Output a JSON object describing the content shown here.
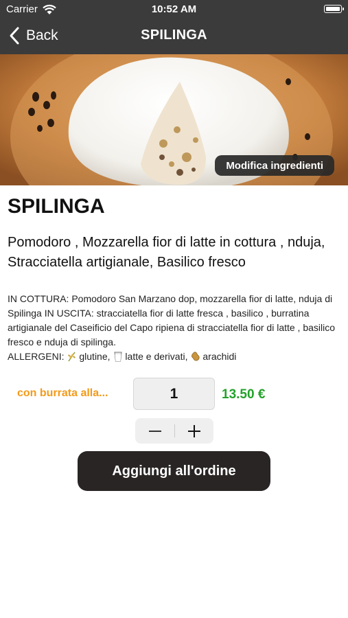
{
  "status": {
    "carrier": "Carrier",
    "time": "10:52 AM"
  },
  "nav": {
    "back_label": "Back",
    "title": "SPILINGA"
  },
  "hero": {
    "edit_label": "Modifica ingredienti"
  },
  "product": {
    "name": "SPILINGA",
    "ingredients": "Pomodoro , Mozzarella fior di latte in cottura , nduja, Stracciatella artigianale, Basilico fresco",
    "description": "IN COTTURA: Pomodoro San Marzano dop, mozzarella fior di latte, nduja di Spilinga  IN USCITA: stracciatella fior di latte fresca , basilico , burratina artigianale del Caseificio del Capo ripiena di stracciatella fior di latte , basilico fresco e nduja di spilinga.",
    "allergens_label": "ALLERGENI:",
    "allergens": [
      {
        "icon": "wheat-icon",
        "label": "glutine,"
      },
      {
        "icon": "milk-glass-icon",
        "label": "latte e derivati,"
      },
      {
        "icon": "peanut-icon",
        "label": "arachidi"
      }
    ]
  },
  "order": {
    "variant_label": "con burrata alla...",
    "quantity": "1",
    "price": "13.50 €",
    "add_label": "Aggiungi all'ordine"
  },
  "colors": {
    "nav_bg": "#3b3b3b",
    "variant": "#f39a1a",
    "price": "#22a22a",
    "button_bg": "#2a2525"
  }
}
